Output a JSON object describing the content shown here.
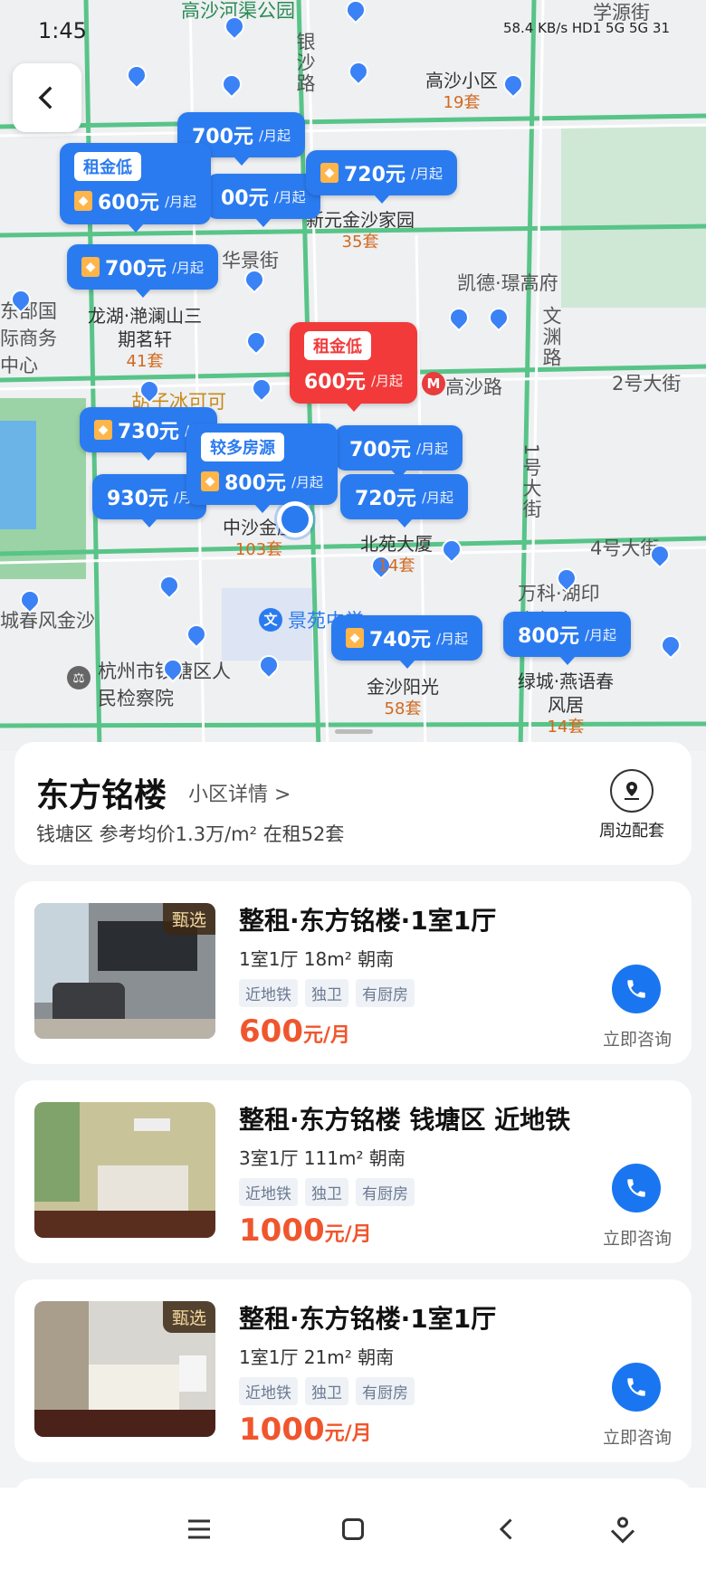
{
  "status_bar": {
    "time": "1:45",
    "icons": "58.4 KB/s  HD1 5G  5G  31"
  },
  "map": {
    "streets": [
      {
        "text": "高沙河渠公园"
      },
      {
        "text": "学源街"
      },
      {
        "text": "银沙路"
      },
      {
        "text": "华景街"
      },
      {
        "text": "凯德·璟高府"
      },
      {
        "text": "文渊路"
      },
      {
        "text": "高沙路"
      },
      {
        "text": "2号大街"
      },
      {
        "text": "1号大街"
      },
      {
        "text": "4号大街"
      },
      {
        "text": "景苑中学"
      },
      {
        "text": "杭州市钱塘区人民检察院"
      },
      {
        "text": "城春风金沙"
      },
      {
        "text": "万科·湖印光年府"
      },
      {
        "text": "东部国际商务中心"
      },
      {
        "text": "胡子冰可可"
      }
    ],
    "communities": [
      {
        "name": "高沙小区",
        "count": "19套"
      },
      {
        "name": "新元金沙家园",
        "count": "35套"
      },
      {
        "name": "龙湖·滟澜山三期茗轩",
        "count": "41套"
      },
      {
        "name": "中沙金座",
        "count": "103套"
      },
      {
        "name": "北苑大厦",
        "count": "14套"
      },
      {
        "name": "金沙阳光",
        "count": "58套"
      },
      {
        "name": "绿城·燕语春风居",
        "count": "14套"
      }
    ],
    "bubbles": [
      {
        "tag": "租金低",
        "price": "600元",
        "unit": "/月起"
      },
      {
        "price": "700元",
        "unit": "/月起"
      },
      {
        "price": "00元",
        "unit": "/月起"
      },
      {
        "price": "720元",
        "unit": "/月起"
      },
      {
        "price": "700元",
        "unit": "/月起"
      },
      {
        "tag": "租金低",
        "price": "600元",
        "unit": "/月起"
      },
      {
        "price": "730元",
        "unit": "/月"
      },
      {
        "tag": "较多房源",
        "price": "800元",
        "unit": "/月起"
      },
      {
        "price": "700元",
        "unit": "/月起"
      },
      {
        "price": "930元",
        "unit": "/月"
      },
      {
        "price": "720元",
        "unit": "/月起"
      },
      {
        "price": "740元",
        "unit": "/月起"
      },
      {
        "price": "800元",
        "unit": "/月起"
      }
    ]
  },
  "summary": {
    "name": "东方铭楼",
    "detail_link": "小区详情 >",
    "meta": "钱塘区 参考均价1.3万/m² 在租52套",
    "nearby_label": "周边配套"
  },
  "listings": [
    {
      "badge": "甄选",
      "title": "整租·东方铭楼·1室1厅",
      "specs": "1室1厅  18m²  朝南",
      "tags": [
        "近地铁",
        "独卫",
        "有厨房"
      ],
      "price": "600",
      "unit": "元/月",
      "consult": "立即咨询"
    },
    {
      "badge": "",
      "title": "整租·东方铭楼 钱塘区 近地铁",
      "specs": "3室1厅  111m²  朝南",
      "tags": [
        "近地铁",
        "独卫",
        "有厨房"
      ],
      "price": "1000",
      "unit": "元/月",
      "consult": "立即咨询"
    },
    {
      "badge": "甄选",
      "title": "整租·东方铭楼·1室1厅",
      "specs": "1室1厅  21m²  朝南",
      "tags": [
        "近地铁",
        "独卫",
        "有厨房"
      ],
      "price": "1000",
      "unit": "元/月",
      "consult": "立即咨询"
    }
  ],
  "navbar": {
    "icons": [
      "menu-icon",
      "home-square-icon",
      "back-triangle-icon",
      "assistant-icon"
    ]
  },
  "colors": {
    "accent": "#2b7bf0",
    "price": "#f0562d",
    "alert": "#f23a3a"
  }
}
